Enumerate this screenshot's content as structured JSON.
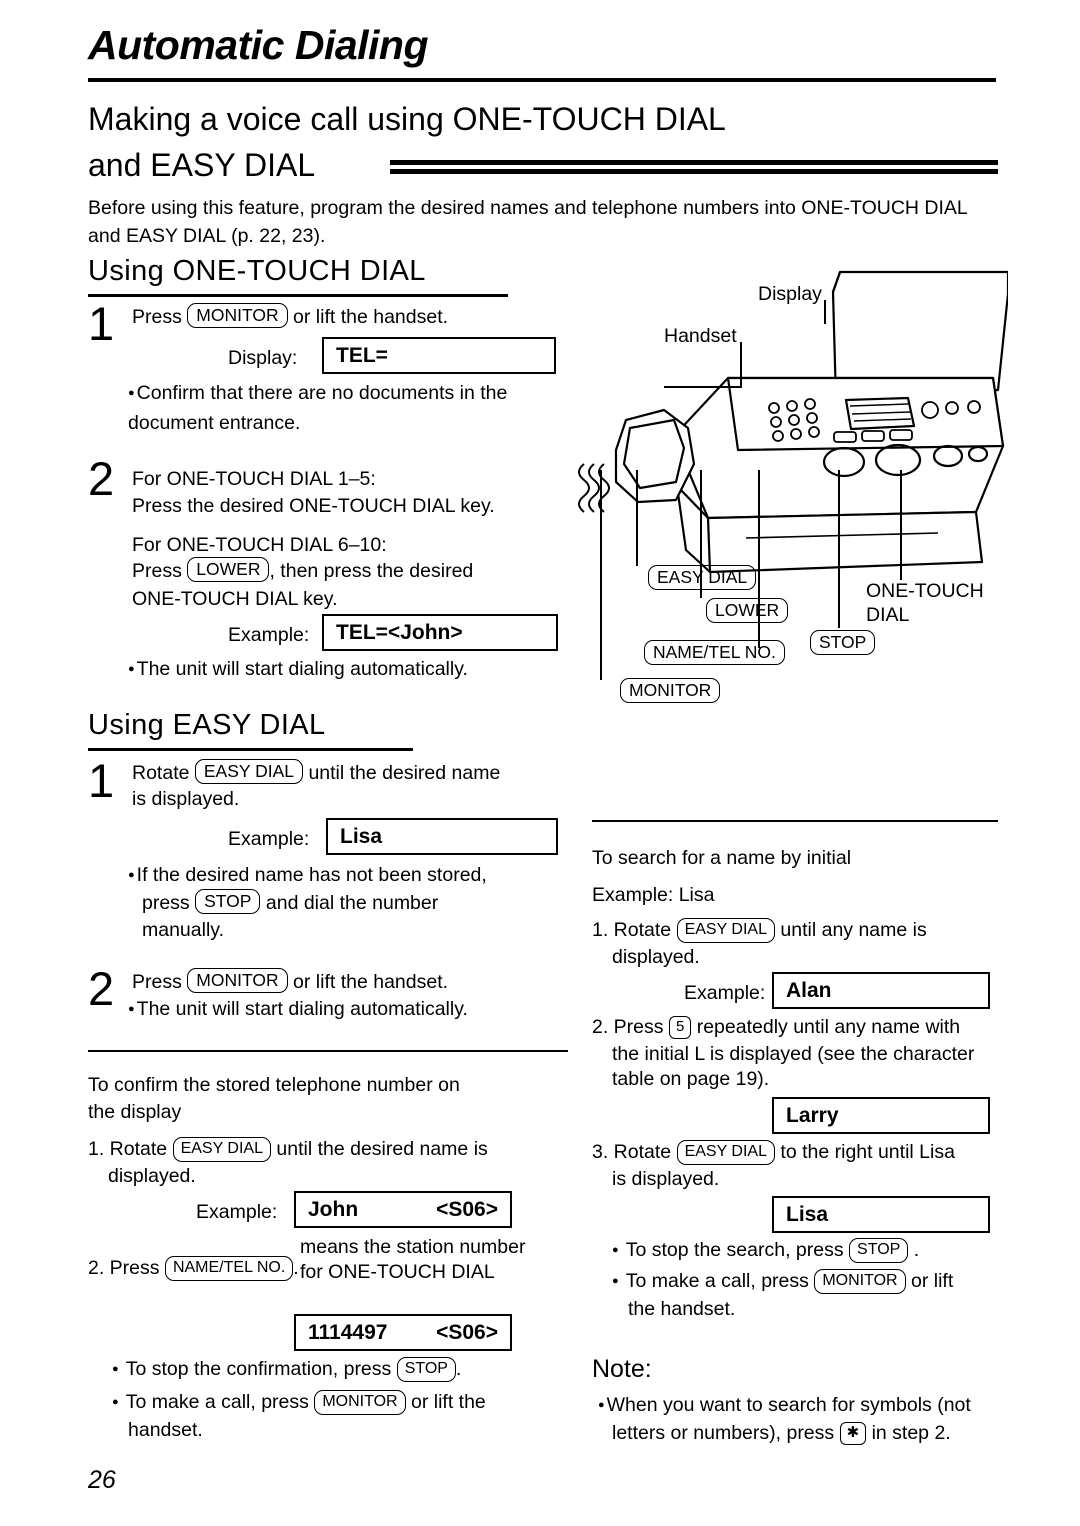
{
  "header": {
    "title": "Automatic Dialing",
    "subtitle_line1": "Making a voice call using ONE-TOUCH DIAL",
    "subtitle_line2": "and EASY DIAL",
    "intro": "Before using this feature, program the desired names and telephone numbers into ONE-TOUCH DIAL and EASY DIAL (p. 22, 23)."
  },
  "section_onetouch": {
    "heading": "Using ONE-TOUCH DIAL",
    "step1_num": "1",
    "step1_line1_pre": "Press",
    "step1_key": "MONITOR",
    "step1_line1_post": "or lift the handset.",
    "step1_display_label": "Display:",
    "step1_display_value": "TEL=",
    "step1_bullet": "Confirm that there are no documents in the document entrance.",
    "step2_num": "2",
    "step2_line1": "For ONE-TOUCH DIAL 1–5:",
    "step2_line2": "Press the desired ONE-TOUCH DIAL key.",
    "step2_line3": "For ONE-TOUCH DIAL 6–10:",
    "step2_line4_pre": "Press",
    "step2_key": "LOWER",
    "step2_line4_post": ", then press the desired",
    "step2_line5": "ONE-TOUCH DIAL key.",
    "example_label": "Example:",
    "example_value": "TEL=<John>",
    "step2_bullet": "The unit will start dialing automatically."
  },
  "section_easy": {
    "heading": "Using EASY DIAL",
    "step1_num": "1",
    "step1_pre": "Rotate",
    "step1_key": "EASY DIAL",
    "step1_post": "until the desired name",
    "step1_line2": "is displayed.",
    "example_label": "Example:",
    "example_value": "Lisa",
    "bullet1_part1": "If the desired name has not been stored,",
    "bullet1_part2_pre": "press",
    "bullet1_key": "STOP",
    "bullet1_part2_post": "and dial the number",
    "bullet1_part3": "manually.",
    "step2_num": "2",
    "step2_pre": "Press",
    "step2_key": "MONITOR",
    "step2_post": "or lift the handset.",
    "step2_bullet": "The unit will start dialing automatically."
  },
  "confirm": {
    "heading_line1": "To confirm the stored telephone number on",
    "heading_line2": "the display",
    "s1_pre": "1. Rotate",
    "s1_key": "EASY DIAL",
    "s1_post": "until the desired name is",
    "s1_line2": "displayed.",
    "example_label": "Example:",
    "lcd_name": "John",
    "lcd_station": "<S06>",
    "note_line1": "means the station number",
    "note_line2": "for ONE-TOUCH DIAL",
    "s2_pre": "2. Press",
    "s2_key": "NAME/TEL NO.",
    "s2_post": ".",
    "lcd2_number": "1114497",
    "lcd2_station": "<S06>",
    "bullet1_pre": "To stop the confirmation, press",
    "bullet1_key": "STOP",
    "bullet1_post": ".",
    "bullet2_pre": "To make a call, press",
    "bullet2_key": "MONITOR",
    "bullet2_post": "or lift the",
    "bullet2_line2": "handset."
  },
  "search": {
    "heading": "To search for a name by initial",
    "example_label_top": "Example:  Lisa",
    "s1_pre": "1. Rotate",
    "s1_key": "EASY DIAL",
    "s1_post": "until any name is",
    "s1_line2": "displayed.",
    "example_label": "Example:",
    "lcd_alan": "Alan",
    "s2_pre": "2. Press",
    "s2_key": "5",
    "s2_post": "repeatedly until any name with",
    "s2_line2": "the initial  L  is displayed (see the character",
    "s2_line3": "table on page 19).",
    "lcd_larry": "Larry",
    "s3_pre": "3. Rotate",
    "s3_key": "EASY DIAL",
    "s3_post": "to the right until  Lisa",
    "s3_line2": "is displayed.",
    "lcd_lisa": "Lisa",
    "bullet1_pre": "To stop the search, press",
    "bullet1_key": "STOP",
    "bullet1_post": ".",
    "bullet2_pre": "To make a call, press",
    "bullet2_key": "MONITOR",
    "bullet2_post": "or lift",
    "bullet2_line2": "the handset."
  },
  "note": {
    "label": "Note:",
    "bullet_line1": "When you want to search for symbols (not",
    "bullet_line2_pre": "letters or numbers), press",
    "bullet_key": "✱",
    "bullet_line2_post": "in step 2."
  },
  "illustration": {
    "label_display": "Display",
    "label_handset": "Handset",
    "key_easy_dial": "EASY DIAL",
    "key_lower": "LOWER",
    "key_name_tel": "NAME/TEL NO.",
    "key_monitor": "MONITOR",
    "key_stop": "STOP",
    "label_onetouch_line1": "ONE-TOUCH",
    "label_onetouch_line2": "DIAL"
  },
  "page_number": "26"
}
